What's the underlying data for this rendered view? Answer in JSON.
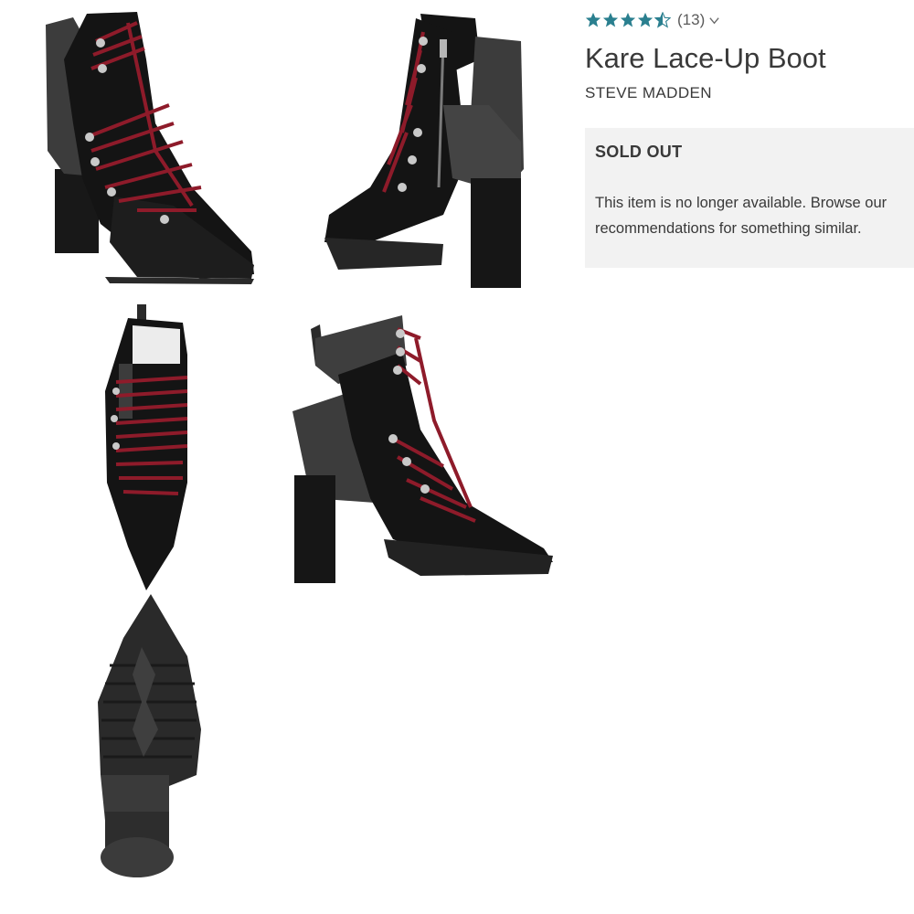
{
  "product": {
    "title": "Kare Lace-Up Boot",
    "brand": "STEVE MADDEN",
    "rating": {
      "stars": 4.5,
      "count_label": "(13)",
      "star_color": "#2a7f8f"
    },
    "availability": {
      "status_label": "SOLD OUT",
      "message": "This item is no longer available. Browse our recommendations for something similar."
    }
  },
  "gallery": {
    "images": [
      {
        "view": "front-three-quarter"
      },
      {
        "view": "inner-side-zipper"
      },
      {
        "view": "top-down"
      },
      {
        "view": "side-profile"
      },
      {
        "view": "outsole"
      }
    ],
    "lace_color": "#8e1b2a",
    "boot_color": "#141414",
    "suede_color": "#3e3e3e"
  },
  "tones": [
    "#f2f2f2",
    "#393939"
  ]
}
